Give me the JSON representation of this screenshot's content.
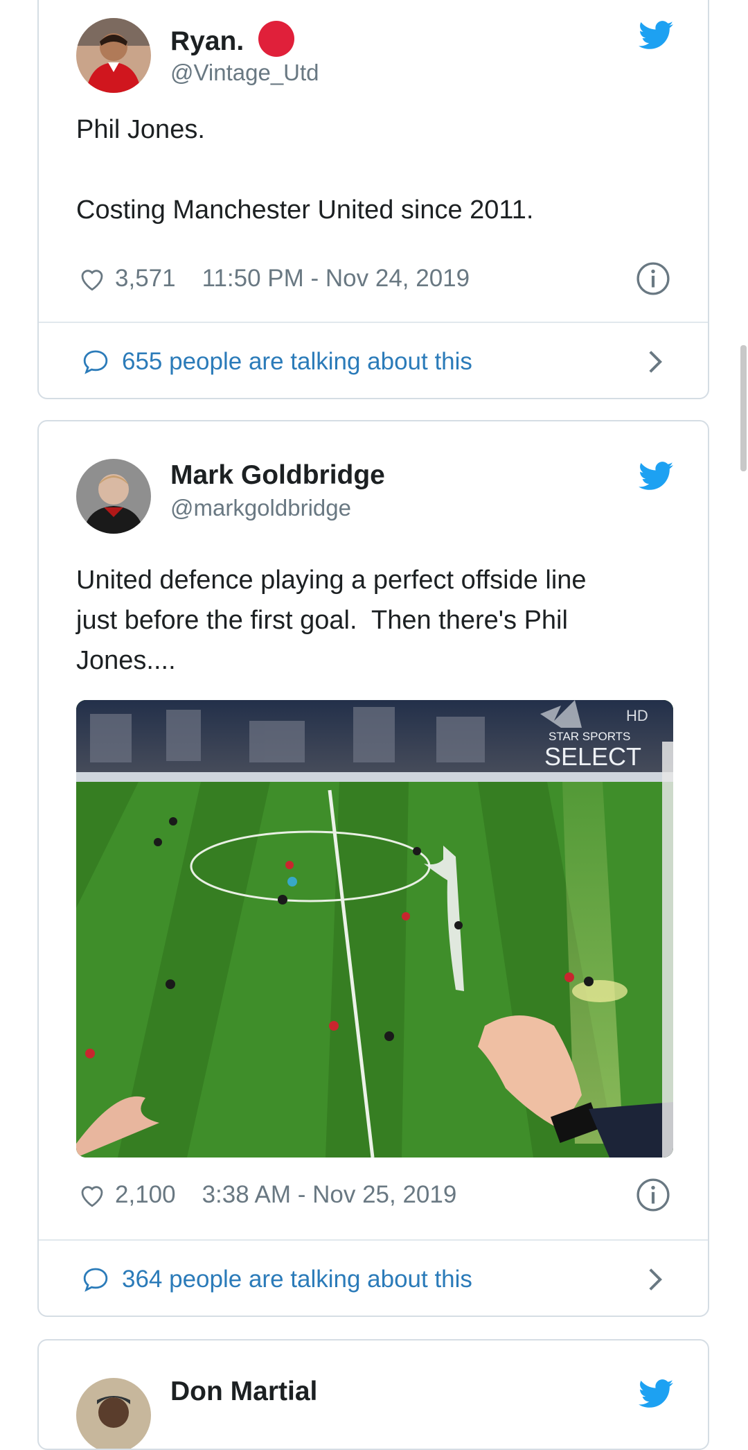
{
  "tweets": [
    {
      "name": "Ryan.",
      "handle": "@Vintage_Utd",
      "text_lines": [
        "Phil Jones.",
        "",
        "Costing Manchester United since 2011."
      ],
      "likes": "3,571",
      "timestamp": "11:50 PM - Nov 24, 2019",
      "talking": "655 people are talking about this",
      "avatar_icon": "player-avatar",
      "name_badge_color": "#e0203a"
    },
    {
      "name": "Mark Goldbridge",
      "handle": "@markgoldbridge",
      "text_lines": [
        "United defence playing a perfect offside line",
        "just before the first goal.  Then there's Phil",
        "Jones...."
      ],
      "likes": "2,100",
      "timestamp": "3:38 AM - Nov 25, 2019",
      "talking": "364 people are talking about this",
      "media": {
        "type": "football-broadcast-still",
        "overlay_brand_line1": "STAR SPORTS",
        "overlay_brand_line2": "SELECT",
        "overlay_hd": "HD"
      }
    },
    {
      "name": "Don Martial"
    }
  ],
  "colors": {
    "twitter_blue": "#1da1f2",
    "link_blue": "#2b7bb9",
    "secondary_text": "#697882",
    "border": "#d5dde4",
    "pitch_green": "#3f8e2a"
  },
  "icons": {
    "brand": "twitter-bird-icon",
    "like": "heart-outline-icon",
    "info": "info-circle-icon",
    "comment": "speech-bubble-icon",
    "open": "chevron-right-icon"
  }
}
